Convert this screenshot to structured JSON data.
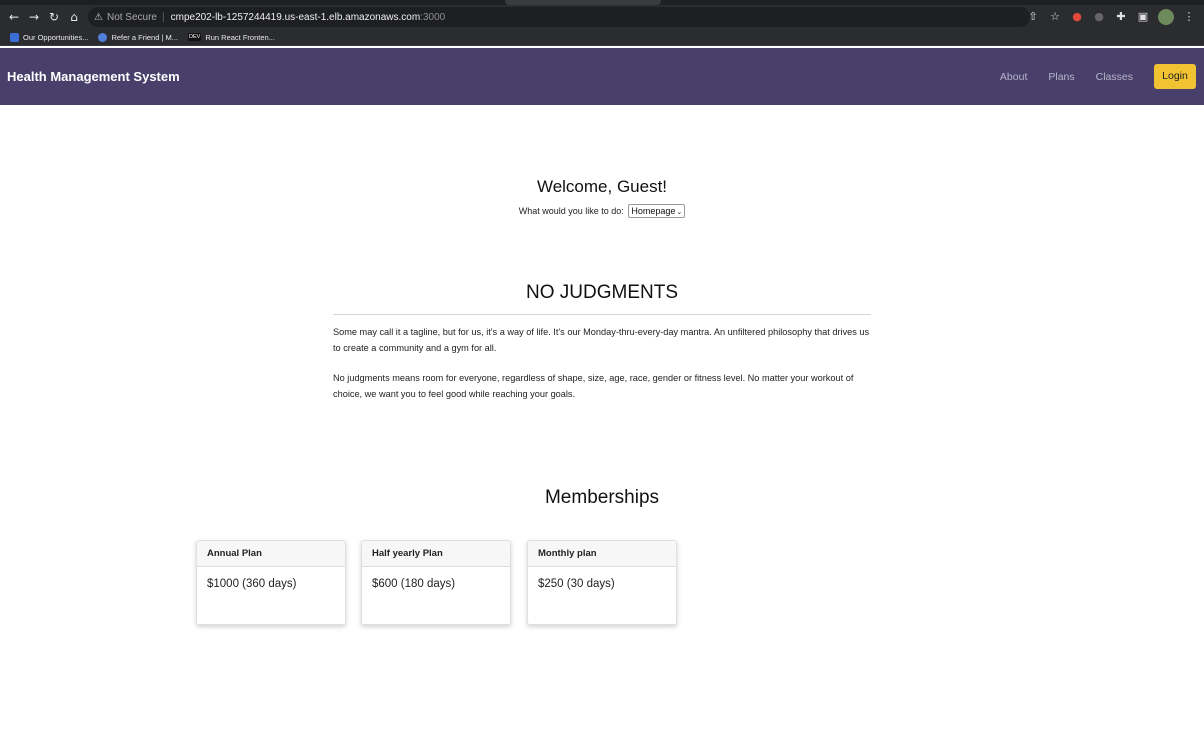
{
  "browser": {
    "nav_icons": [
      "back-icon",
      "forward-icon",
      "reload-icon",
      "home-icon"
    ],
    "security_label": "Not Secure",
    "url_host": "cmpe202-lb-1257244419.us-east-1.elb.amazonaws.com",
    "url_port": ":3000",
    "bookmarks": [
      {
        "label": "Our Opportunities...",
        "color": "#3b6fd8"
      },
      {
        "label": "Refer a Friend | M...",
        "color": "#4f7fd9"
      },
      {
        "label": "Run React Fronten...",
        "color": "#222222",
        "badge": "DEV"
      }
    ]
  },
  "navbar": {
    "brand": "Health Management System",
    "links": [
      "About",
      "Plans",
      "Classes"
    ],
    "login_label": "Login",
    "bg_color": "#48406a",
    "login_color": "#f1c232"
  },
  "welcome": {
    "title": "Welcome, Guest!",
    "prompt": "What would you like to do:",
    "selected_option": "Homepage"
  },
  "no_judgments": {
    "title": "NO JUDGMENTS",
    "paragraph1": "Some may call it a tagline, but for us, it's a way of life. It's our Monday-thru-every-day mantra. An unfiltered philosophy that drives us to create a community and a gym for all.",
    "paragraph2": "No judgments means room for everyone, regardless of shape, size, age, race, gender or fitness level. No matter your workout of choice, we want you to feel good while reaching your goals."
  },
  "memberships": {
    "title": "Memberships",
    "plans": [
      {
        "name": "Annual Plan",
        "price": "$1000 (360 days)"
      },
      {
        "name": "Half yearly Plan",
        "price": "$600 (180 days)"
      },
      {
        "name": "Monthly plan",
        "price": "$250 (30 days)"
      }
    ]
  }
}
